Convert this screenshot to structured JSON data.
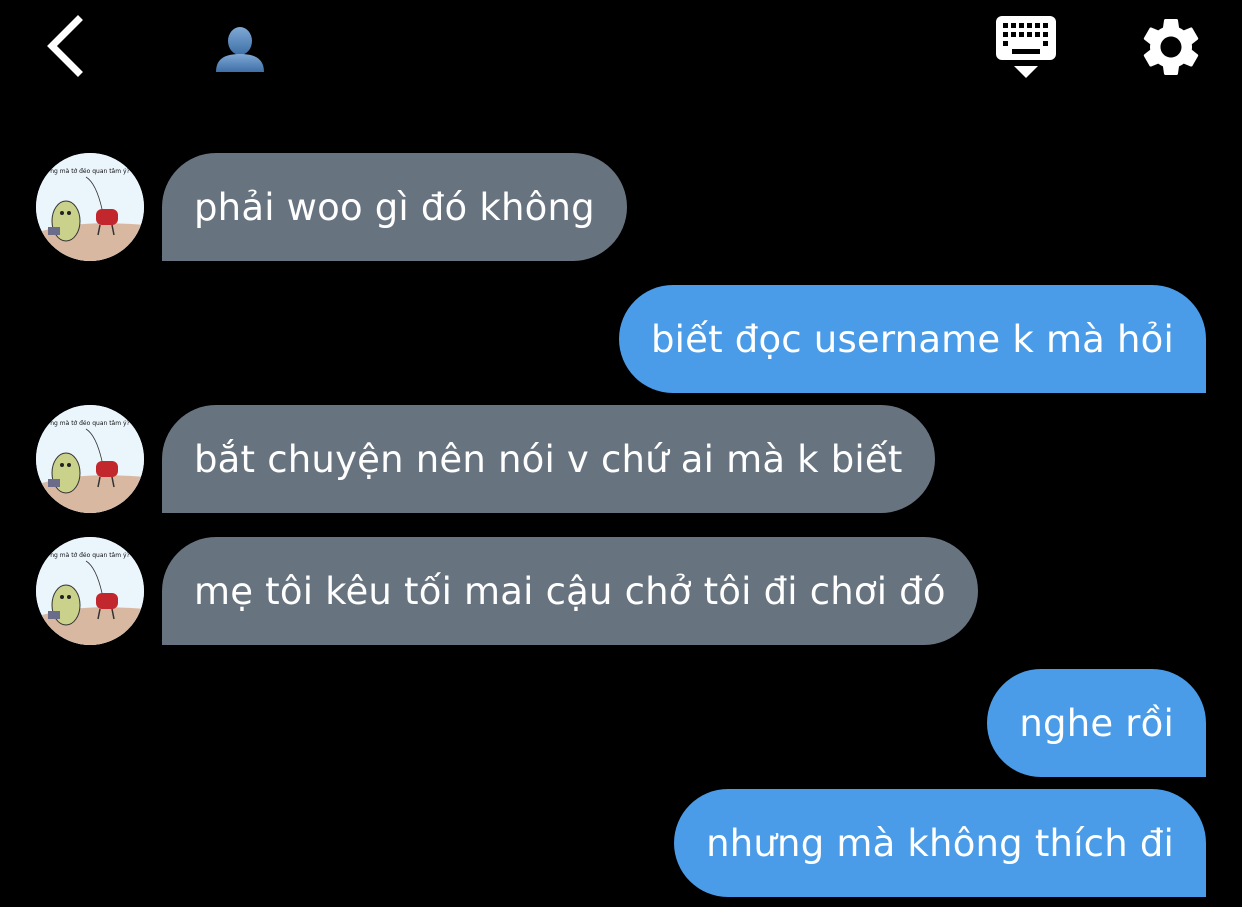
{
  "header": {
    "back_icon": "chevron-left-icon",
    "profile_icon": "person-silhouette-icon",
    "keyboard_icon": "keyboard-hide-icon",
    "settings_icon": "gear-icon"
  },
  "colors": {
    "background": "#000000",
    "incoming_bubble": "#67737f",
    "outgoing_bubble": "#4a9be8",
    "text": "#ffffff"
  },
  "avatar": {
    "caption": "ng mà tớ đéo quan tâm ý?"
  },
  "messages": [
    {
      "direction": "incoming",
      "text": "phải woo gì đó không"
    },
    {
      "direction": "outgoing",
      "text": "biết đọc username k mà hỏi"
    },
    {
      "direction": "incoming",
      "text": "bắt chuyện nên nói v chứ ai mà k biết"
    },
    {
      "direction": "incoming",
      "text": "mẹ tôi kêu tối mai cậu chở tôi đi chơi đó"
    },
    {
      "direction": "outgoing",
      "text": "nghe rồi"
    },
    {
      "direction": "outgoing",
      "text": "nhưng mà không thích đi"
    }
  ]
}
